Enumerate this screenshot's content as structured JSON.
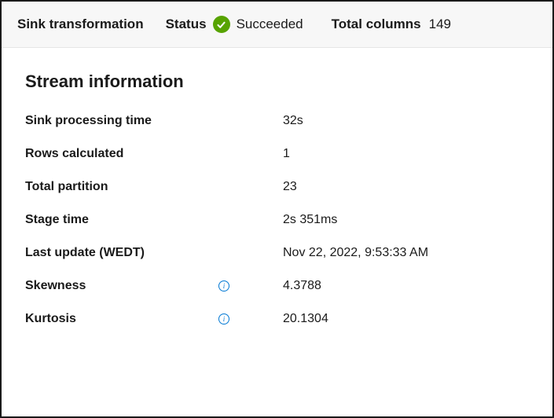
{
  "header": {
    "transformation_label": "Sink transformation",
    "status_label": "Status",
    "status_value": "Succeeded",
    "total_columns_label": "Total columns",
    "total_columns_value": "149"
  },
  "section_title": "Stream information",
  "rows": [
    {
      "label": "Sink processing time",
      "value": "32s",
      "has_info": false
    },
    {
      "label": "Rows calculated",
      "value": "1",
      "has_info": false
    },
    {
      "label": "Total partition",
      "value": "23",
      "has_info": false
    },
    {
      "label": "Stage time",
      "value": "2s 351ms",
      "has_info": false
    },
    {
      "label": "Last update (WEDT)",
      "value": "Nov 22, 2022, 9:53:33 AM",
      "has_info": false
    },
    {
      "label": "Skewness",
      "value": "4.3788",
      "has_info": true
    },
    {
      "label": "Kurtosis",
      "value": "20.1304",
      "has_info": true
    }
  ]
}
